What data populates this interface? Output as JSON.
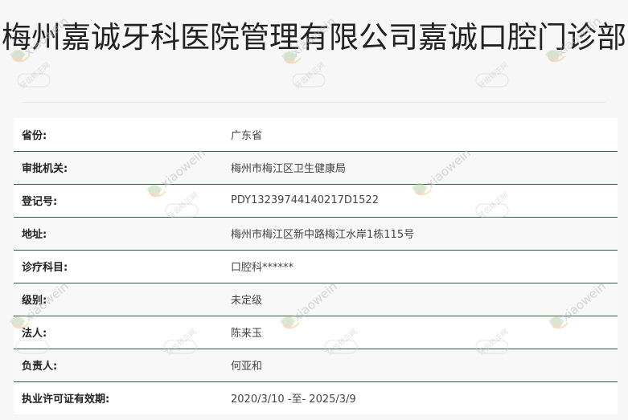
{
  "header": {
    "title": "梅州嘉诚牙科医院管理有限公司嘉诚口腔门诊部"
  },
  "rows": [
    {
      "label": "省份:",
      "value": "广东省"
    },
    {
      "label": "审批机关:",
      "value": "梅州市梅江区卫生健康局"
    },
    {
      "label": "登记号:",
      "value": "PDY13239744140217D1522"
    },
    {
      "label": "地址:",
      "value": "梅州市梅江区新中路梅江水岸1栋115号"
    },
    {
      "label": "诊疗科目:",
      "value": "口腔科******"
    },
    {
      "label": "级别:",
      "value": "未定级"
    },
    {
      "label": "法人:",
      "value": "陈来玉"
    },
    {
      "label": "负责人:",
      "value": "何亚和"
    },
    {
      "label": "执业许可证有效期:",
      "value": "2020/3/10 -至- 2025/3/9"
    }
  ],
  "watermark": {
    "text": "xiaowein",
    "subtext": "牙齿矫正网"
  },
  "colors": {
    "row_border": "#2f5e3c",
    "background": "#f7f7f7",
    "title_text": "#222222"
  }
}
